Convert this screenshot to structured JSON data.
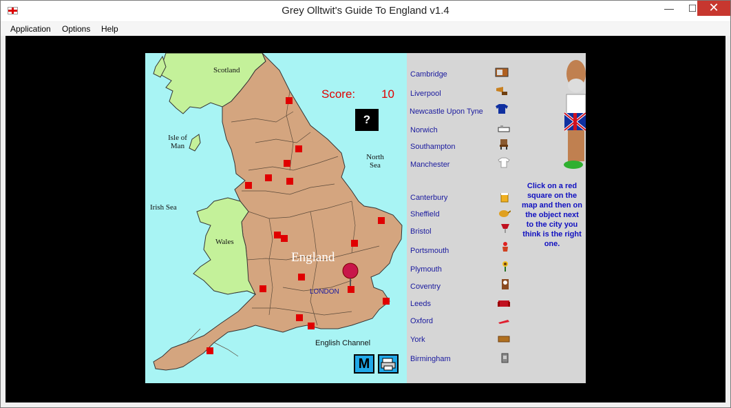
{
  "window": {
    "title": "Grey Olltwit's Guide To England v1.4",
    "minimize": "—",
    "maximize": "☐",
    "close": "✕"
  },
  "menu": [
    "Application",
    "Options",
    "Help"
  ],
  "score": {
    "label": "Score:",
    "value": "10"
  },
  "help_button": "?",
  "map_labels": {
    "scotland": "Scotland",
    "isle_of_man": "Isle of Man",
    "north_sea": "North Sea",
    "irish_sea": "Irish Sea",
    "wales": "Wales",
    "england": "England",
    "london": "LONDON",
    "english_channel": "English Channel"
  },
  "map_button_label": "M",
  "cities": [
    "Cambridge",
    "Liverpool",
    "Newcastle Upon Tyne",
    "Norwich",
    "Southampton",
    "Manchester",
    "Canterbury",
    "Sheffield",
    "Bristol",
    "Portsmouth",
    "Plymouth",
    "Coventry",
    "Leeds",
    "Oxford",
    "York",
    "Birmingham"
  ],
  "objects": [
    "radio-icon",
    "gramophone-icon",
    "shirt-icon",
    "mustard-tin-icon",
    "chair-icon",
    "t-shirt-icon",
    "beer-mug-icon",
    "teapot-icon",
    "wine-glass-icon",
    "flower-pot-icon",
    "sunflower-icon",
    "clock-icon",
    "sofa-icon",
    "lipstick-icon",
    "chocolate-bar-icon",
    "mug-icon"
  ],
  "instructions": "Click on a red square on the map and then on the object next to the city you think is the right one.",
  "colors": {
    "sea": "#a8f4f4",
    "england": "#d4a57f",
    "scotland_wales": "#c4f19a",
    "score": "#e00000",
    "city_text": "#1a1a9e",
    "marker": "#e00000"
  }
}
